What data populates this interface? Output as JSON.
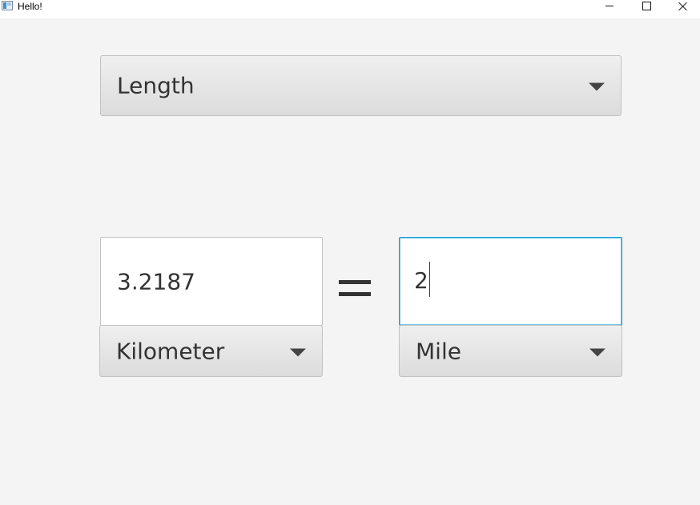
{
  "window": {
    "title": "Hello!",
    "icon": "app-window-icon",
    "controls": [
      "minimize-icon",
      "maximize-icon",
      "close-icon"
    ]
  },
  "category": {
    "selected": "Length",
    "icon": "chevron-down-icon"
  },
  "from": {
    "value": "3.2187",
    "unit": "Kilometer"
  },
  "to": {
    "value": "2",
    "unit": "Mile"
  },
  "operator": "equals-icon",
  "colors": {
    "background": "#f4f4f4",
    "focus_border": "#1a9ed8",
    "text": "#333333"
  }
}
